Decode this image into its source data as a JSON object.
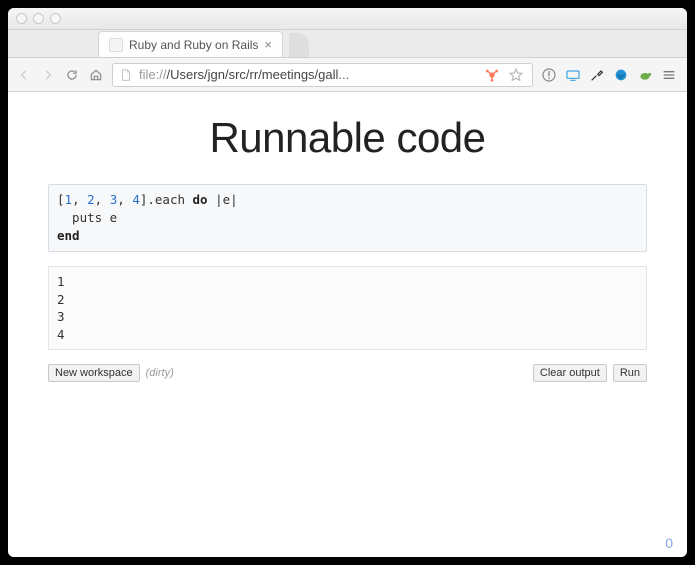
{
  "window": {
    "tab_title": "Ruby and Ruby on Rails",
    "url_scheme": "file://",
    "url_path": "/Users/jgn/src/rr/meetings/gall",
    "url_truncation": "..."
  },
  "slide": {
    "title": "Runnable code",
    "code_tokens": [
      {
        "t": "[",
        "c": ""
      },
      {
        "t": "1",
        "c": "num"
      },
      {
        "t": ", ",
        "c": ""
      },
      {
        "t": "2",
        "c": "num"
      },
      {
        "t": ", ",
        "c": ""
      },
      {
        "t": "3",
        "c": "num"
      },
      {
        "t": ", ",
        "c": ""
      },
      {
        "t": "4",
        "c": "num"
      },
      {
        "t": "].each ",
        "c": ""
      },
      {
        "t": "do",
        "c": "kw"
      },
      {
        "t": " |e|\n  puts e\n",
        "c": ""
      },
      {
        "t": "end",
        "c": "kw"
      }
    ],
    "output": "1\n2\n3\n4",
    "controls": {
      "new_workspace": "New workspace",
      "status": "(dirty)",
      "clear_output": "Clear output",
      "run": "Run"
    },
    "page_number": "0"
  },
  "icons": {
    "back": "back-icon",
    "forward": "forward-icon",
    "reload": "reload-icon",
    "home": "home-icon",
    "close_tab": "×",
    "star": "star-icon"
  }
}
